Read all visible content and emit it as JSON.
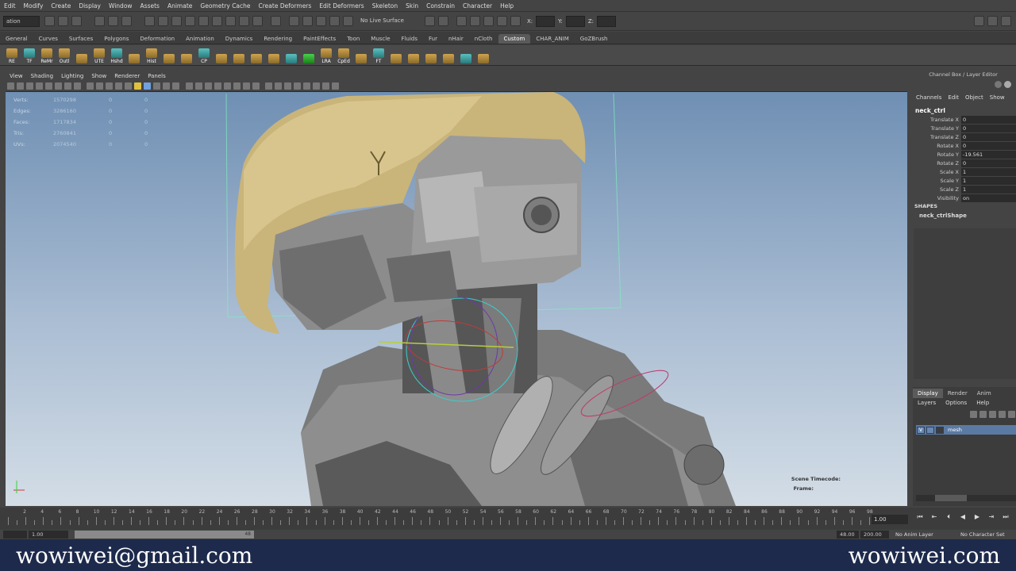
{
  "menubar": [
    "Edit",
    "Modify",
    "Create",
    "Display",
    "Window",
    "Assets",
    "Animate",
    "Geometry Cache",
    "Create Deformers",
    "Edit Deformers",
    "Skeleton",
    "Skin",
    "Constrain",
    "Character",
    "Help"
  ],
  "status": {
    "mode": "ation",
    "live_surface": "No Live Surface",
    "x_label": "X:",
    "y_label": "Y:",
    "z_label": "Z:"
  },
  "shelf_tabs": [
    "General",
    "Curves",
    "Surfaces",
    "Polygons",
    "Deformation",
    "Animation",
    "Dynamics",
    "Rendering",
    "PaintEffects",
    "Toon",
    "Muscle",
    "Fluids",
    "Fur",
    "nHair",
    "nCloth",
    "Custom",
    "CHAR_ANIM",
    "GoZBrush"
  ],
  "shelf_active": "Custom",
  "shelf_buttons": [
    "RE",
    "TF",
    "ReMr",
    "Outl",
    "",
    "UTE",
    "Hshd",
    "",
    "Hist",
    "",
    "",
    "CP",
    "",
    "",
    "",
    "",
    "",
    "",
    "LRA",
    "CpEd",
    "",
    "FT",
    "",
    "",
    "",
    "",
    "",
    ""
  ],
  "viewport_menu": [
    "View",
    "Shading",
    "Lighting",
    "Show",
    "Renderer",
    "Panels"
  ],
  "hud": [
    {
      "label": "Verts:",
      "v": "1570298",
      "a": "0",
      "b": "0"
    },
    {
      "label": "Edges:",
      "v": "3286160",
      "a": "0",
      "b": "0"
    },
    {
      "label": "Faces:",
      "v": "1717834",
      "a": "0",
      "b": "0"
    },
    {
      "label": "Tris:",
      "v": "2760841",
      "a": "0",
      "b": "0"
    },
    {
      "label": "UVs:",
      "v": "2074540",
      "a": "0",
      "b": "0"
    }
  ],
  "scene_timecode": "Scene Timecode:",
  "frame_label": "Frame:",
  "channel_box": {
    "title": "Channel Box / Layer Editor",
    "menu": [
      "Channels",
      "Edit",
      "Object",
      "Show"
    ],
    "object": "neck_ctrl",
    "attrs": [
      {
        "name": "Translate X",
        "value": "0"
      },
      {
        "name": "Translate Y",
        "value": "0"
      },
      {
        "name": "Translate Z",
        "value": "0"
      },
      {
        "name": "Rotate X",
        "value": "0"
      },
      {
        "name": "Rotate Y",
        "value": "-19.561"
      },
      {
        "name": "Rotate Z",
        "value": "0"
      },
      {
        "name": "Scale X",
        "value": "1"
      },
      {
        "name": "Scale Y",
        "value": "1"
      },
      {
        "name": "Scale Z",
        "value": "1"
      },
      {
        "name": "Visibility",
        "value": "on"
      }
    ],
    "shapes_header": "SHAPES",
    "shape_name": "neck_ctrlShape"
  },
  "layer_editor": {
    "tabs": [
      "Display",
      "Render",
      "Anim"
    ],
    "menu": [
      "Layers",
      "Options",
      "Help"
    ],
    "layer": {
      "v": "V",
      "name": "mesh"
    }
  },
  "timeline": {
    "ticks": [
      "2",
      "4",
      "6",
      "8",
      "10",
      "12",
      "14",
      "16",
      "18",
      "20",
      "22",
      "24",
      "26",
      "28",
      "30",
      "32",
      "34",
      "36",
      "38",
      "40",
      "42",
      "44",
      "46",
      "48",
      "50",
      "52",
      "54",
      "56",
      "58",
      "60",
      "62",
      "64",
      "66",
      "68",
      "70",
      "72",
      "74",
      "76",
      "78",
      "80",
      "82",
      "84",
      "86",
      "88",
      "90",
      "92",
      "94",
      "96",
      "98"
    ],
    "current": "1.00",
    "range_start": "1.00",
    "range_bar_end": "48",
    "range_end": "48.00",
    "anim_end": "200.00",
    "anim_layer": "No Anim Layer",
    "char_set": "No Character Set"
  },
  "footer": {
    "email": "wowiwei@gmail.com",
    "site": "wowiwei.com"
  }
}
